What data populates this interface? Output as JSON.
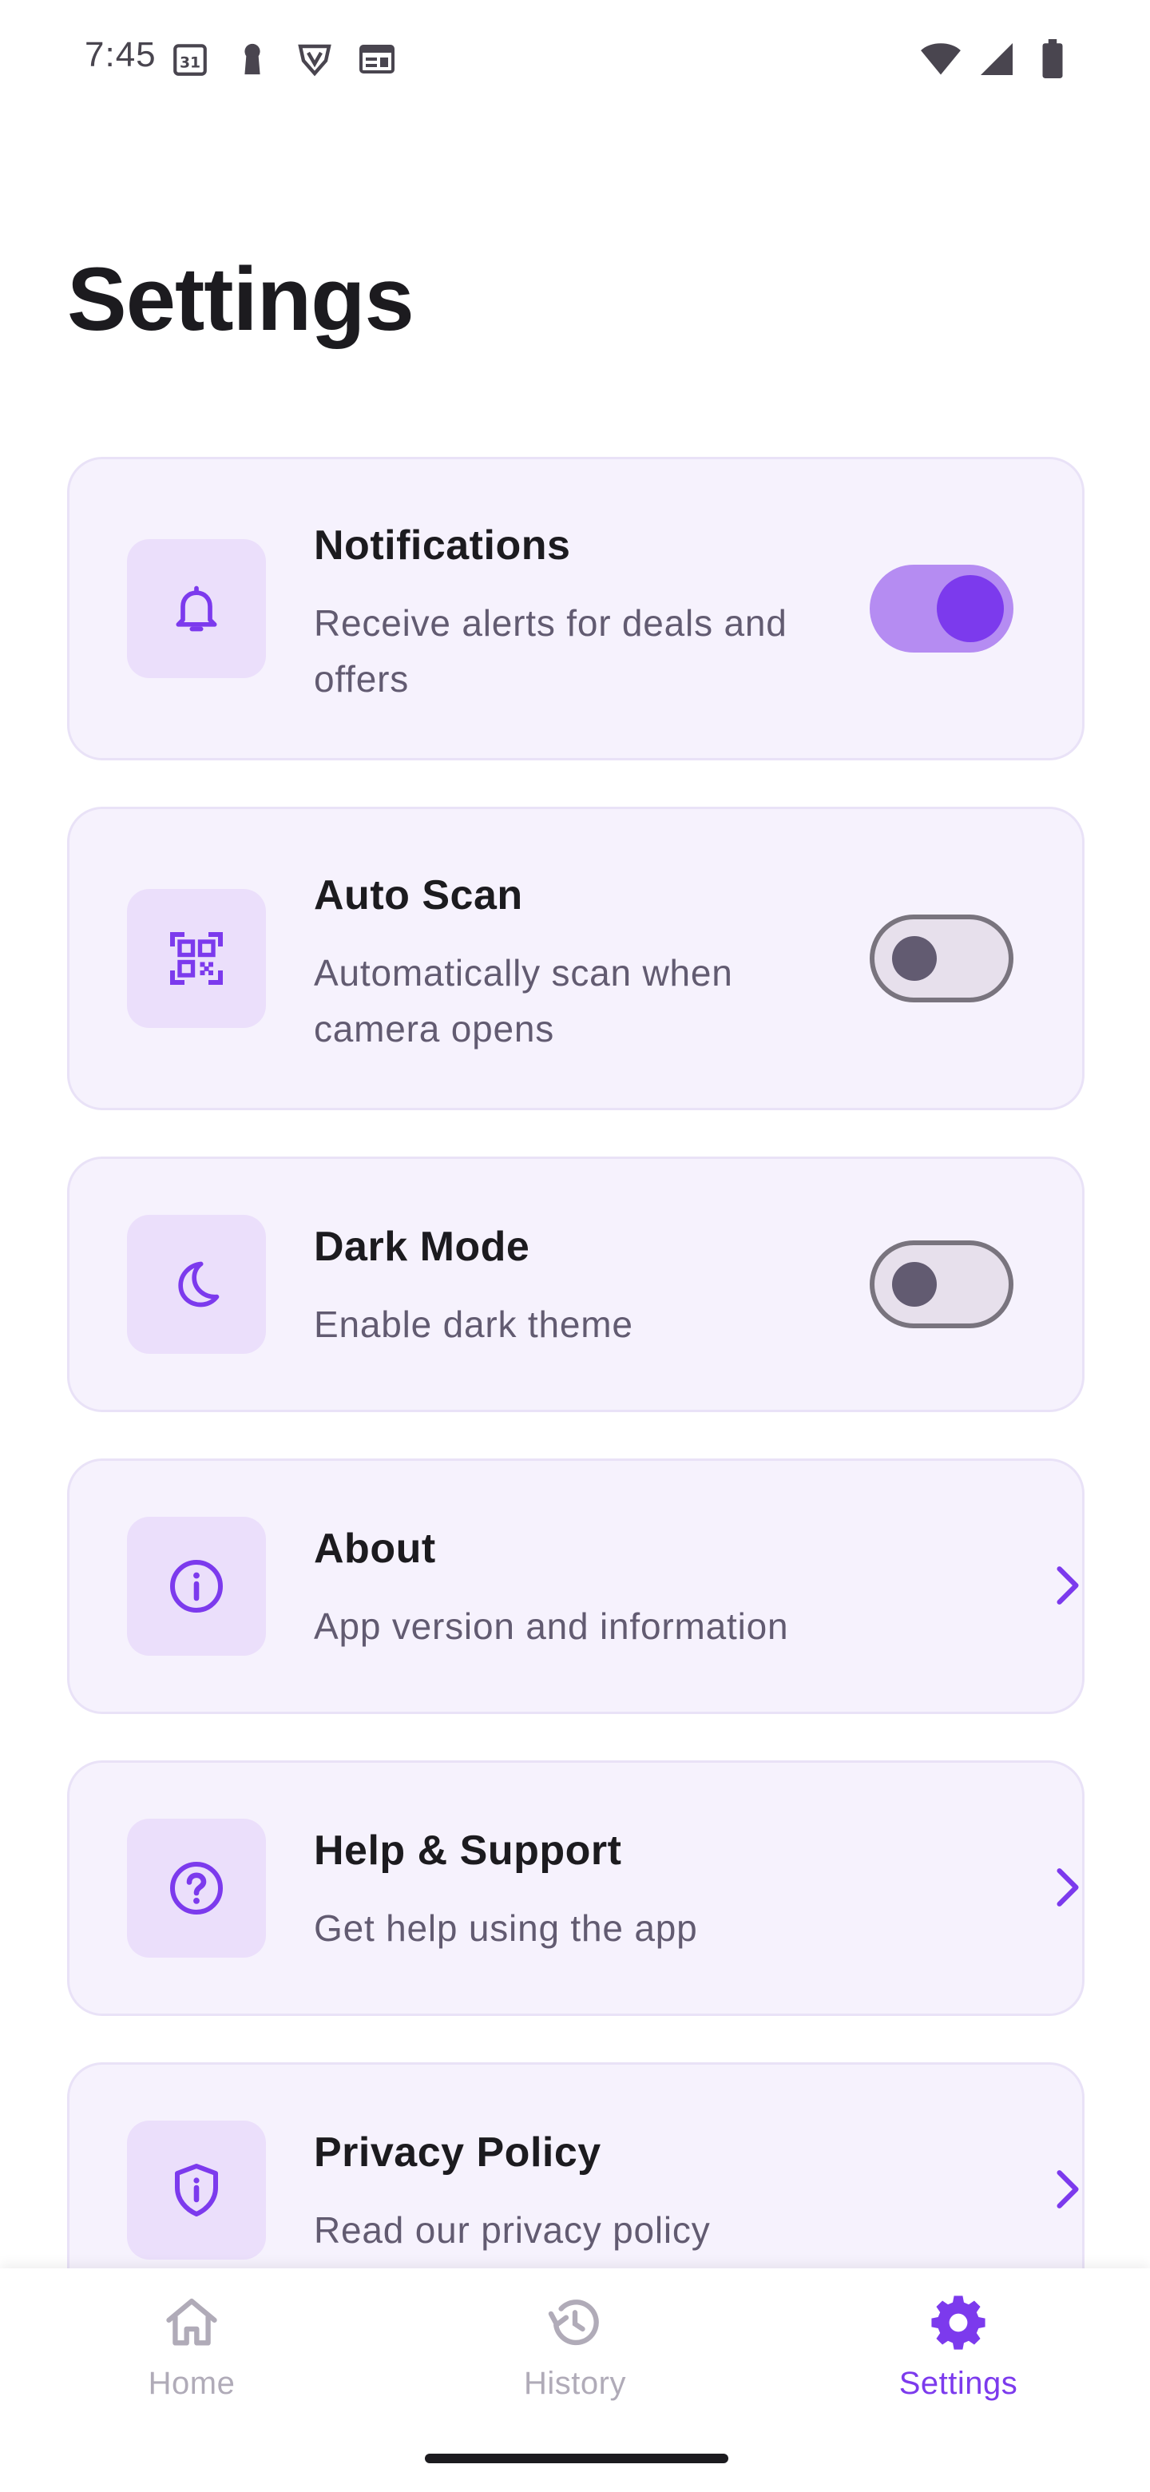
{
  "status_bar": {
    "time": "7:45",
    "left_icons": [
      "calendar-31-icon",
      "keyhole-icon",
      "vpn-shield-icon",
      "newspaper-icon"
    ],
    "right_icons": [
      "wifi-icon",
      "signal-icon",
      "battery-icon"
    ]
  },
  "page": {
    "title": "Settings"
  },
  "accent_color": "#7c3aed",
  "settings": [
    {
      "id": "notifications",
      "icon": "bell-icon",
      "title": "Notifications",
      "subtitle": "Receive alerts for deals and offers",
      "control": "toggle",
      "enabled": true
    },
    {
      "id": "auto-scan",
      "icon": "qr-scan-icon",
      "title": "Auto Scan",
      "subtitle": "Automatically scan when camera opens",
      "control": "toggle",
      "enabled": false
    },
    {
      "id": "dark-mode",
      "icon": "moon-icon",
      "title": "Dark Mode",
      "subtitle": "Enable dark theme",
      "control": "toggle",
      "enabled": false
    },
    {
      "id": "about",
      "icon": "info-icon",
      "title": "About",
      "subtitle": "App version and information",
      "control": "chevron"
    },
    {
      "id": "help-support",
      "icon": "help-circle-icon",
      "title": "Help & Support",
      "subtitle": "Get help using the app",
      "control": "chevron"
    },
    {
      "id": "privacy-policy",
      "icon": "shield-info-icon",
      "title": "Privacy Policy",
      "subtitle": "Read our privacy policy",
      "control": "chevron"
    }
  ],
  "bottom_nav": {
    "items": [
      {
        "id": "home",
        "label": "Home",
        "icon": "home-icon",
        "active": false
      },
      {
        "id": "history",
        "label": "History",
        "icon": "history-icon",
        "active": false
      },
      {
        "id": "settings",
        "label": "Settings",
        "icon": "gear-icon",
        "active": true
      }
    ]
  }
}
